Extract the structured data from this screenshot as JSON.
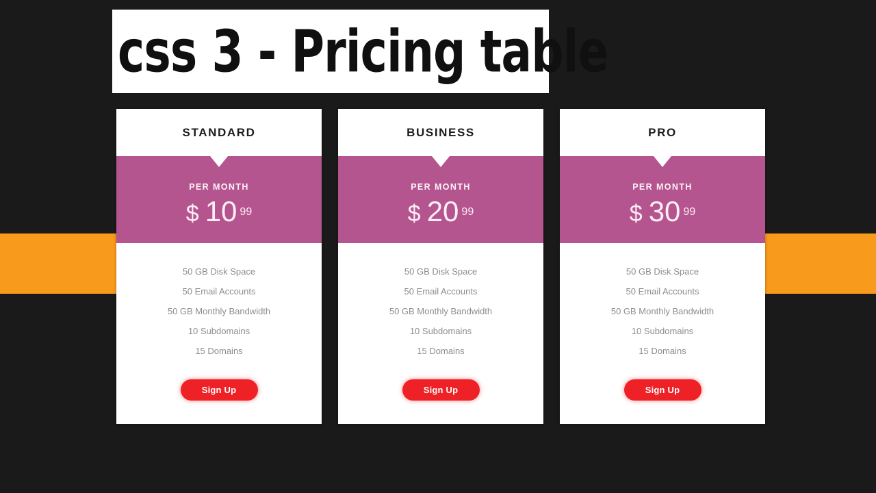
{
  "page": {
    "background_color": "#1a1a1a",
    "title_banner": {
      "text": "css 3 - Pricing table",
      "background_color": "#ffffff",
      "text_color": "#101010"
    },
    "accent_bars": {
      "color": "#f89a1c",
      "left_label": "orange-accent-bar-left",
      "right_label": "orange-accent-bar-right"
    }
  },
  "colors": {
    "price_band": "#b5558f",
    "signup_button": "#ee2127",
    "feature_text": "#8d8d8d",
    "card_background": "#ffffff"
  },
  "plans": [
    {
      "name": "STANDARD",
      "period_label": "PER MONTH",
      "currency": "$",
      "amount": "10",
      "cents": "99",
      "features": [
        "50 GB Disk Space",
        "50 Email Accounts",
        "50 GB Monthly Bandwidth",
        "10 Subdomains",
        "15 Domains"
      ],
      "cta_label": "Sign Up"
    },
    {
      "name": "BUSINESS",
      "period_label": "PER MONTH",
      "currency": "$",
      "amount": "20",
      "cents": "99",
      "features": [
        "50 GB Disk Space",
        "50 Email Accounts",
        "50 GB Monthly Bandwidth",
        "10 Subdomains",
        "15 Domains"
      ],
      "cta_label": "Sign Up"
    },
    {
      "name": "PRO",
      "period_label": "PER MONTH",
      "currency": "$",
      "amount": "30",
      "cents": "99",
      "features": [
        "50 GB Disk Space",
        "50 Email Accounts",
        "50 GB Monthly Bandwidth",
        "10 Subdomains",
        "15 Domains"
      ],
      "cta_label": "Sign Up"
    }
  ]
}
